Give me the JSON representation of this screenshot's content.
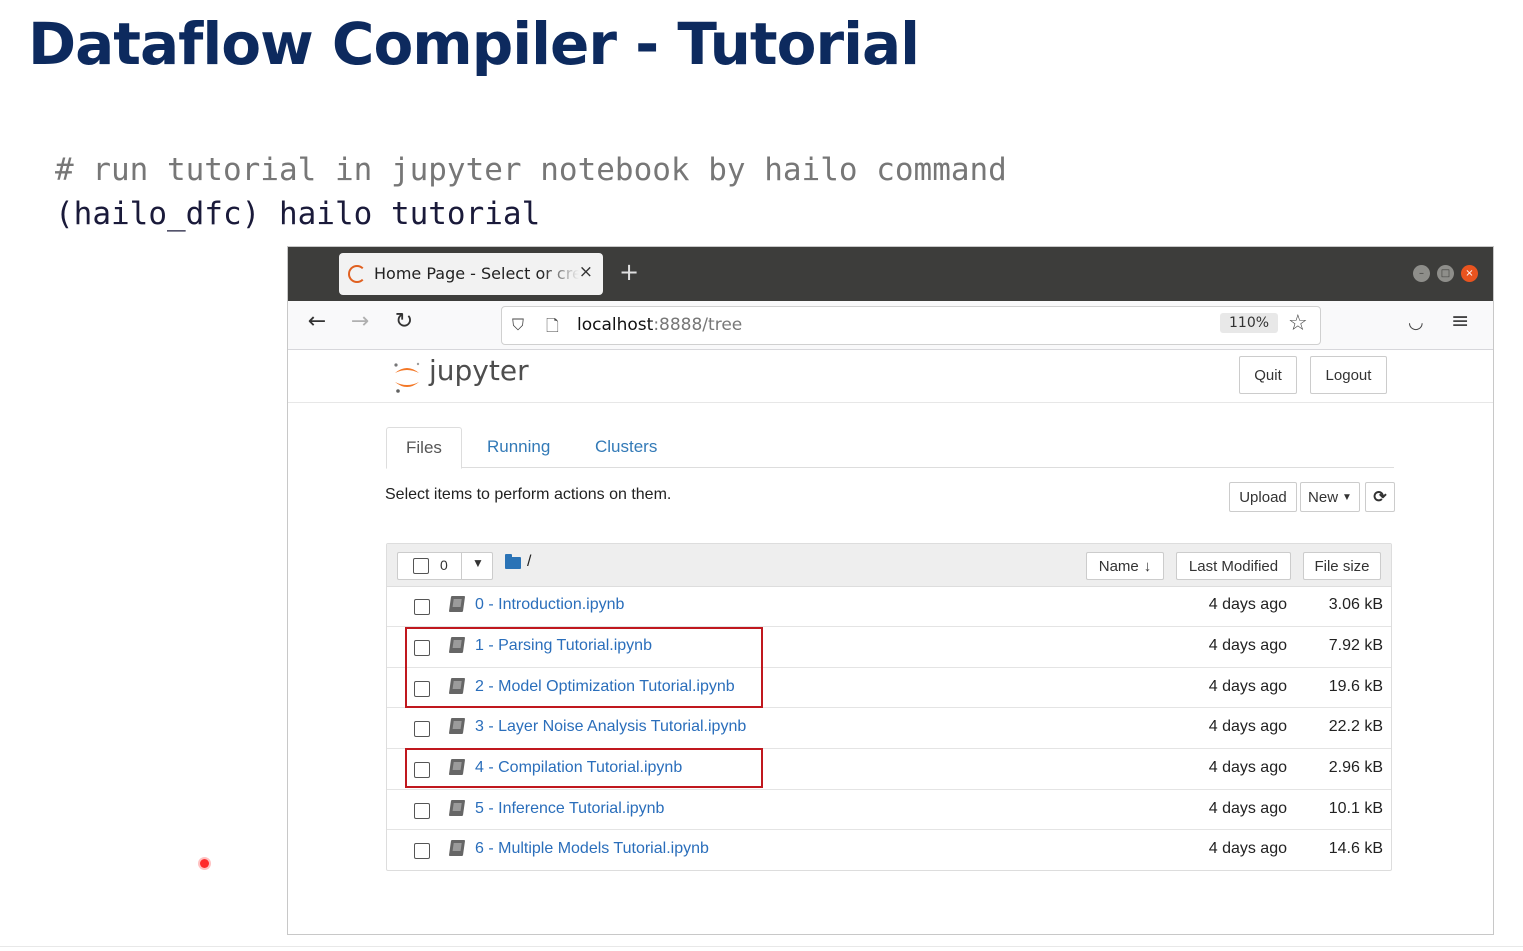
{
  "slide": {
    "title": "Dataflow Compiler - Tutorial",
    "comment_line": "# run tutorial in jupyter notebook by hailo command",
    "command_line": "(hailo_dfc) hailo tutorial"
  },
  "browser": {
    "tab_title": "Home Page - Select or create a notebook",
    "tab_close": "×",
    "new_tab": "+",
    "url_host": "localhost",
    "url_rest": ":8888/tree",
    "zoom": "110%",
    "icons": {
      "back": "arrow-left-icon",
      "forward": "arrow-right-icon",
      "reload": "reload-icon",
      "shield": "shield-icon",
      "page": "page-icon",
      "bookmark": "star-icon",
      "pocket": "pocket-icon",
      "menu": "hamburger-menu-icon"
    }
  },
  "jupyter": {
    "logo_text": "jupyter",
    "quit_label": "Quit",
    "logout_label": "Logout",
    "tabs": [
      {
        "label": "Files",
        "active": true
      },
      {
        "label": "Running",
        "active": false
      },
      {
        "label": "Clusters",
        "active": false
      }
    ],
    "instructions": "Select items to perform actions on them.",
    "upload_label": "Upload",
    "new_label": "New",
    "refresh_icon": "refresh-icon",
    "selected_count": "0",
    "path": "/",
    "columns": {
      "name": "Name",
      "last_modified": "Last Modified",
      "file_size": "File size"
    },
    "files": [
      {
        "name": "0 - Introduction.ipynb",
        "modified": "4 days ago",
        "size": "3.06 kB",
        "highlighted": false
      },
      {
        "name": "1 - Parsing Tutorial.ipynb",
        "modified": "4 days ago",
        "size": "7.92 kB",
        "highlighted": true
      },
      {
        "name": "2 - Model Optimization Tutorial.ipynb",
        "modified": "4 days ago",
        "size": "19.6 kB",
        "highlighted": true
      },
      {
        "name": "3 - Layer Noise Analysis Tutorial.ipynb",
        "modified": "4 days ago",
        "size": "22.2 kB",
        "highlighted": false
      },
      {
        "name": "4 - Compilation Tutorial.ipynb",
        "modified": "4 days ago",
        "size": "2.96 kB",
        "highlighted": true
      },
      {
        "name": "5 - Inference Tutorial.ipynb",
        "modified": "4 days ago",
        "size": "10.1 kB",
        "highlighted": false
      },
      {
        "name": "6 - Multiple Models Tutorial.ipynb",
        "modified": "4 days ago",
        "size": "14.6 kB",
        "highlighted": false
      }
    ]
  },
  "colors": {
    "title": "#0d2a5e",
    "link": "#2a6ebb",
    "highlight": "#c0181e",
    "jupyter_orange": "#f37726"
  }
}
